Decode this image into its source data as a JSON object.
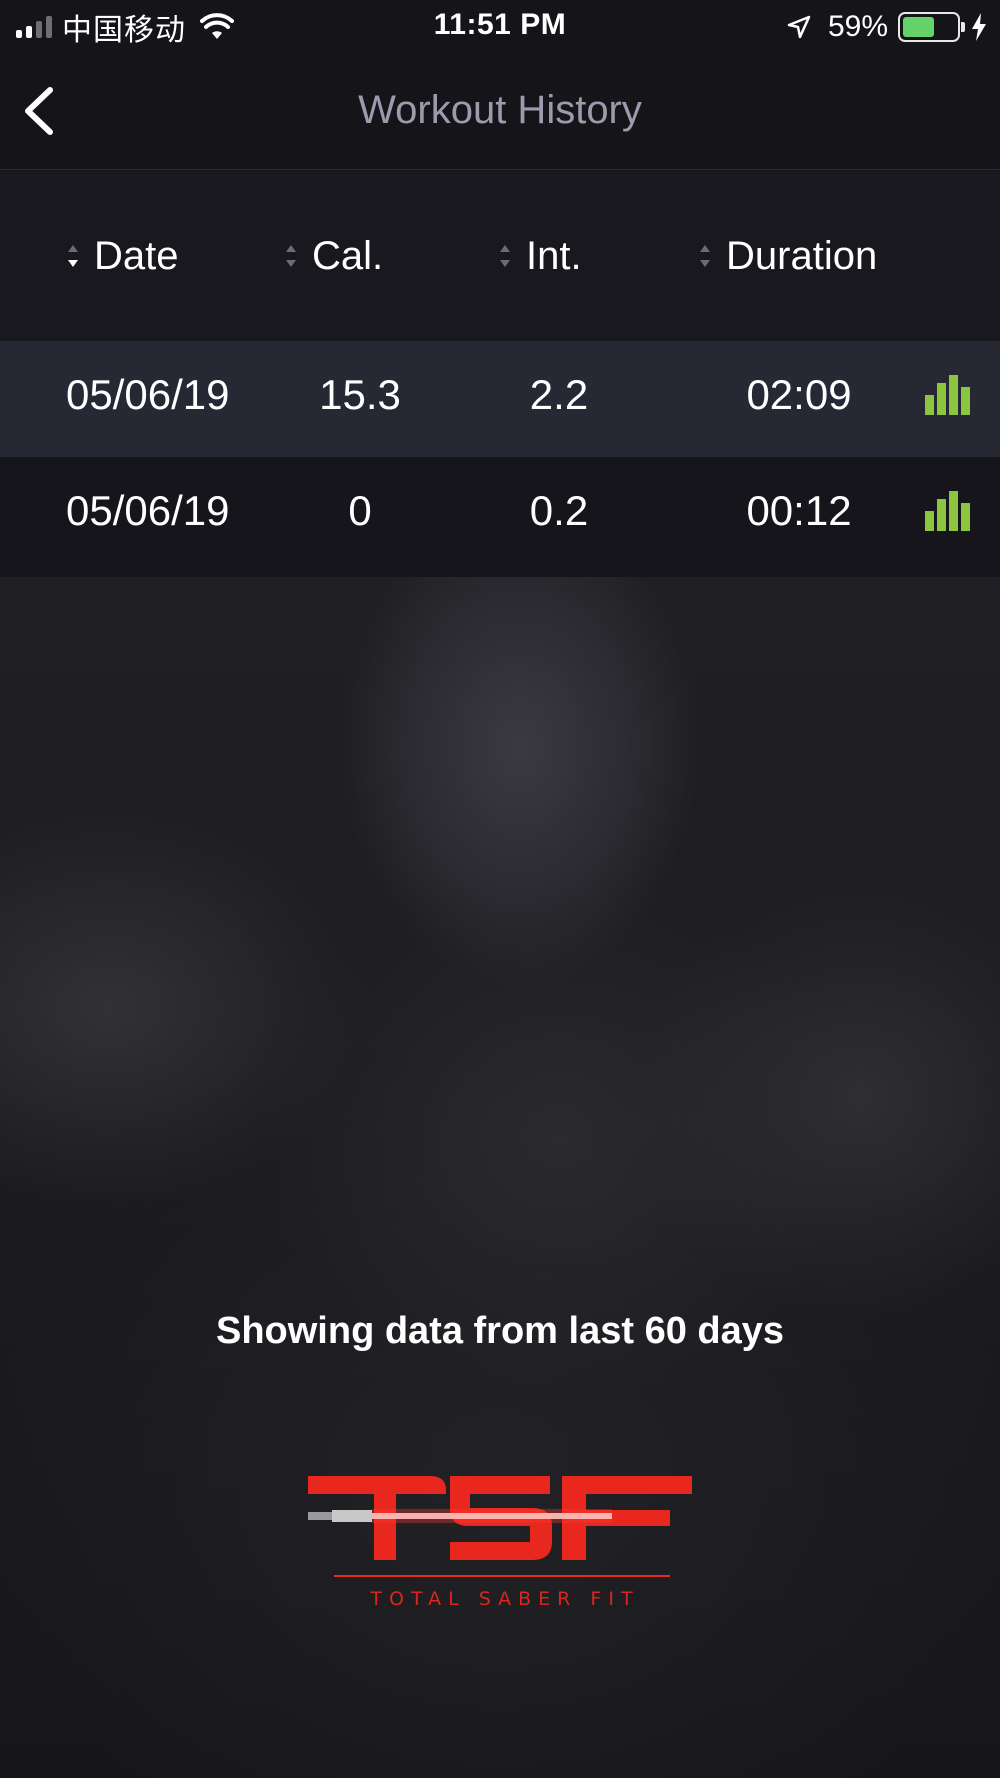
{
  "status_bar": {
    "carrier": "中国移动",
    "time": "11:51 PM",
    "battery_percent": "59%",
    "battery_level": 0.59,
    "battery_color": "#66d26a",
    "icons": [
      "signal-icon",
      "wifi-icon",
      "location-arrow-icon",
      "battery-icon",
      "charging-bolt-icon"
    ]
  },
  "nav": {
    "title": "Workout History",
    "back_icon": "chevron-left-icon"
  },
  "table": {
    "columns": [
      {
        "label": "Date",
        "sort_icon": "sort-icon",
        "active": true
      },
      {
        "label": "Cal.",
        "sort_icon": "sort-icon",
        "active": false
      },
      {
        "label": "Int.",
        "sort_icon": "sort-icon",
        "active": false
      },
      {
        "label": "Duration",
        "sort_icon": "sort-icon",
        "active": false
      }
    ],
    "rows": [
      {
        "date": "05/06/19",
        "cal": "15.3",
        "int": "2.2",
        "duration": "02:09",
        "icon": "bar-chart-icon",
        "highlighted": true
      },
      {
        "date": "05/06/19",
        "cal": "0",
        "int": "0.2",
        "duration": "00:12",
        "icon": "bar-chart-icon",
        "highlighted": false
      }
    ]
  },
  "caption": "Showing data from last 60 days",
  "logo": {
    "text": "TSF",
    "subtitle": "TOTAL SABER FIT",
    "color": "#e8281e"
  },
  "colors": {
    "accent_green": "#8cc63f",
    "row_highlight": "#262834",
    "nav_title": "#9a9cad"
  }
}
